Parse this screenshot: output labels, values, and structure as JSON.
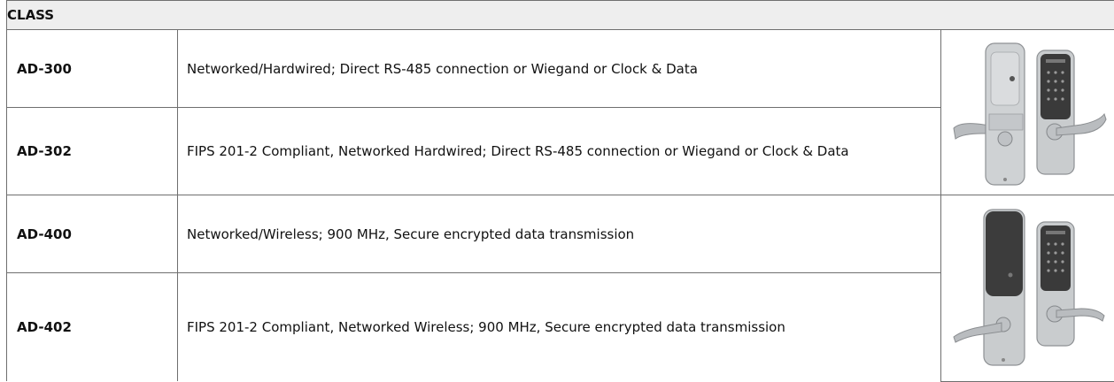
{
  "table": {
    "header_label": "CLASS",
    "rows": [
      {
        "class": "AD-300",
        "description": "Networked/Hardwired; Direct RS-485 connection or Wiegand or Clock & Data"
      },
      {
        "class": "AD-302",
        "description": "FIPS 201-2 Compliant, Networked Hardwired; Direct RS-485 connection or Wiegand or Clock & Data"
      },
      {
        "class": "AD-400",
        "description": "Networked/Wireless; 900 MHz, Secure encrypted data transmission"
      },
      {
        "class": "AD-402",
        "description": "FIPS 201-2 Compliant, Networked Wireless; 900 MHz, Secure encrypted data transmission"
      }
    ],
    "images": [
      {
        "icon": "hardwired-lock-image",
        "body_color": "#c9ccce",
        "keypad_color": "#3a3a3a"
      },
      {
        "icon": "wireless-lock-image",
        "body_color": "#3c3c3c",
        "keypad_color": "#3a3a3a"
      }
    ]
  }
}
